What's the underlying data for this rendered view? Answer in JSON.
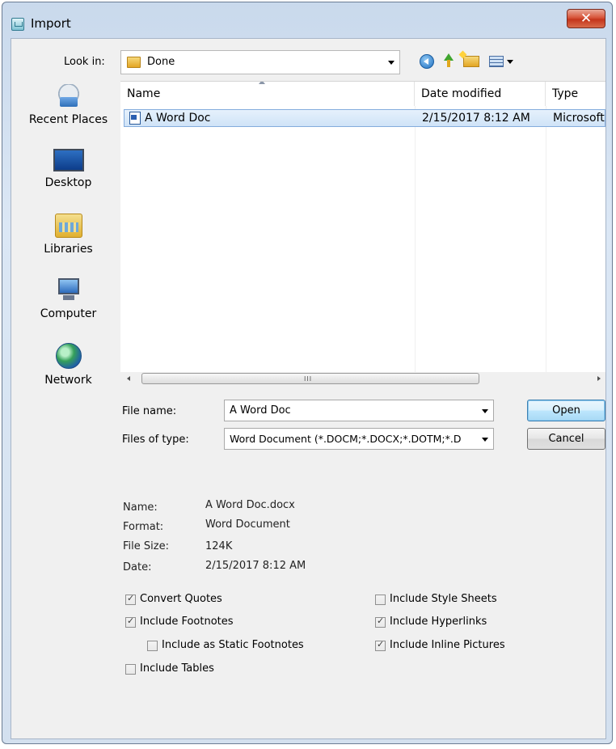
{
  "window": {
    "title": "Import",
    "close_glyph": "✕"
  },
  "look_in": {
    "label": "Look in:",
    "value": "Done",
    "folder_icon": "folder-icon"
  },
  "places": [
    {
      "label": "Recent Places",
      "icon": "recent-places-icon"
    },
    {
      "label": "Desktop",
      "icon": "desktop-icon"
    },
    {
      "label": "Libraries",
      "icon": "libraries-icon"
    },
    {
      "label": "Computer",
      "icon": "computer-icon"
    },
    {
      "label": "Network",
      "icon": "network-icon"
    }
  ],
  "file_list": {
    "columns": [
      "Name",
      "Date modified",
      "Type"
    ],
    "rows": [
      {
        "name": "A Word Doc",
        "date": "2/15/2017 8:12 AM",
        "type": "Microsoft"
      }
    ],
    "scroll_grip": "III"
  },
  "file_name": {
    "label": "File name:",
    "value": "A Word Doc"
  },
  "file_type": {
    "label": "Files of type:",
    "value": "Word Document (*.DOCM;*.DOCX;*.DOTM;*.D"
  },
  "buttons": {
    "open": "Open",
    "cancel": "Cancel"
  },
  "info": {
    "name_key": "Name:",
    "name_val": "A Word Doc.docx",
    "format_key": "Format:",
    "format_val": "Word Document",
    "size_key": "File Size:",
    "size_val": "124K",
    "date_key": "Date:",
    "date_val": "2/15/2017 8:12 AM"
  },
  "options": {
    "convert_quotes": {
      "label": "Convert Quotes",
      "checked": true
    },
    "include_footnotes": {
      "label": "Include Footnotes",
      "checked": true
    },
    "include_static_footnotes": {
      "label": "Include as Static Footnotes",
      "checked": false
    },
    "include_tables": {
      "label": "Include Tables",
      "checked": false
    },
    "include_style_sheets": {
      "label": "Include Style Sheets",
      "checked": false
    },
    "include_hyperlinks": {
      "label": "Include Hyperlinks",
      "checked": true
    },
    "include_inline_pictures": {
      "label": "Include Inline Pictures",
      "checked": true
    }
  }
}
